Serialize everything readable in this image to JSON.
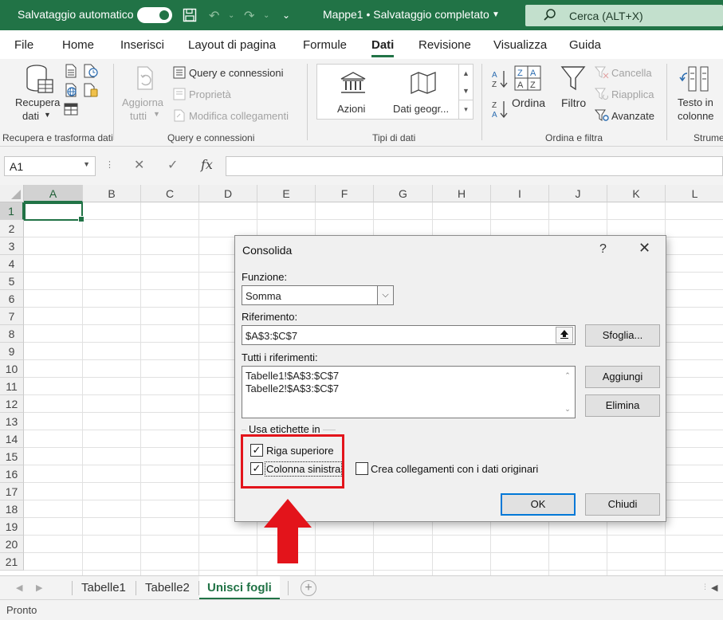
{
  "titlebar": {
    "autosave_label": "Salvataggio automatico",
    "autosave_state": "on",
    "doc_title": "Mappe1 • Salvataggio completato",
    "search_placeholder": "Cerca (ALT+X)"
  },
  "tabs": [
    "File",
    "Home",
    "Inserisci",
    "Layout di pagina",
    "Formule",
    "Dati",
    "Revisione",
    "Visualizza",
    "Guida"
  ],
  "active_tab": "Dati",
  "ribbon": {
    "get_data": {
      "label_line1": "Recupera",
      "label_line2": "dati",
      "group": "Recupera e trasforma dati"
    },
    "refresh": {
      "label_line1": "Aggiorna",
      "label_line2": "tutti",
      "queries": "Query e connessioni",
      "properties": "Proprietà",
      "edit_links": "Modifica collegamenti",
      "group": "Query e connessioni"
    },
    "data_types": {
      "stocks": "Azioni",
      "geography": "Dati geogr...",
      "group": "Tipi di dati"
    },
    "sort_filter": {
      "sort": "Ordina",
      "filter": "Filtro",
      "clear": "Cancella",
      "reapply": "Riapplica",
      "advanced": "Avanzate",
      "group": "Ordina e filtra"
    },
    "tools": {
      "label_line1": "Testo in",
      "label_line2": "colonne",
      "group": "Strume"
    }
  },
  "formula_bar": {
    "name_box": "A1",
    "fx": "fx",
    "formula": ""
  },
  "grid": {
    "columns": [
      "A",
      "B",
      "C",
      "D",
      "E",
      "F",
      "G",
      "H",
      "I",
      "J",
      "K",
      "L"
    ],
    "rows": [
      "1",
      "2",
      "3",
      "4",
      "5",
      "6",
      "7",
      "8",
      "9",
      "10",
      "11",
      "12",
      "13",
      "14",
      "15",
      "16",
      "17",
      "18",
      "19",
      "20",
      "21"
    ],
    "selected_cell": "A1"
  },
  "sheets": {
    "tabs": [
      "Tabelle1",
      "Tabelle2",
      "Unisci fogli"
    ],
    "active": "Unisci fogli"
  },
  "status": "Pronto",
  "dialog": {
    "title": "Consolida",
    "help": "?",
    "close": "✕",
    "function_label": "Funzione:",
    "function_value": "Somma",
    "reference_label": "Riferimento:",
    "reference_value": "$A$3:$C$7",
    "browse_button": "Sfoglia...",
    "all_refs_label": "Tutti i riferimenti:",
    "all_refs": [
      "Tabelle1!$A$3:$C$7",
      "Tabelle2!$A$3:$C$7"
    ],
    "add_button": "Aggiungi",
    "delete_button": "Elimina",
    "labels_group": "Usa etichette in",
    "top_row": {
      "label": "Riga superiore",
      "checked": true
    },
    "left_column": {
      "label": "Colonna sinistra",
      "checked": true
    },
    "links": {
      "label": "Crea collegamenti con i dati originari",
      "checked": false
    },
    "ok_button": "OK",
    "close_button": "Chiudi"
  },
  "colors": {
    "excel_green": "#217346",
    "annotation_red": "#e3141b",
    "focus_blue": "#0078d7"
  }
}
